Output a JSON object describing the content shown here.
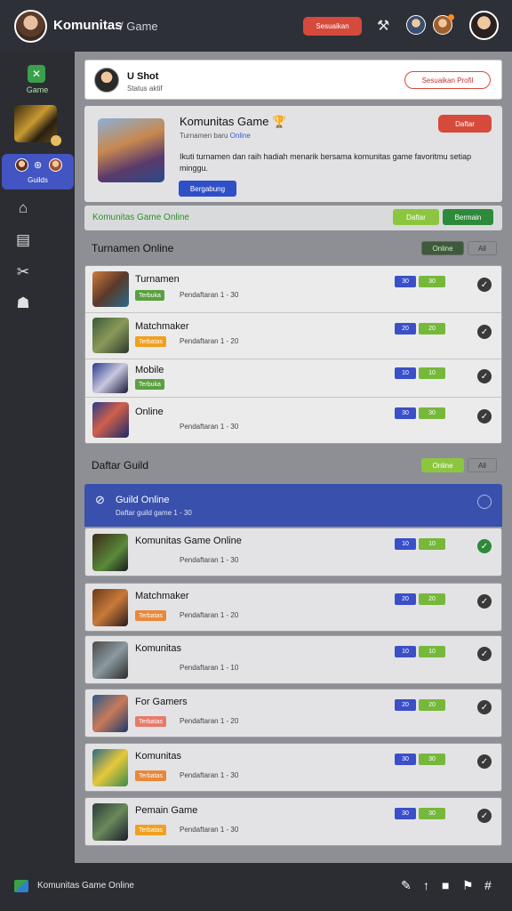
{
  "header": {
    "app_title": "Komunitas",
    "app_subtitle": "/ Game",
    "action_button_label": "Sesuaikan",
    "tool_icon": "wrench-icon"
  },
  "sidebar": {
    "logo_label": "Game",
    "active_item_label": "Guilds",
    "items": [
      "home-icon",
      "list-icon",
      "tools-icon",
      "gamepad-icon"
    ]
  },
  "profile_card": {
    "name": "U Shot",
    "subtitle": "Status aktif",
    "button_label": "Sesuaikan Profil"
  },
  "promo": {
    "title": "Komunitas Game",
    "subtitle": "Turnamen baru",
    "subtitle_highlight": "Online",
    "description": "Ikuti turnamen dan raih hadiah menarik bersama komunitas game favoritmu setiap minggu.",
    "primary_button": "Bergabung",
    "red_button": "Daftar"
  },
  "strip": {
    "text": "Komunitas Game Online",
    "button1": "Daftar",
    "button2": "Bermain"
  },
  "section1": {
    "title": "Turnamen Online",
    "button1": "Online",
    "button2": "All"
  },
  "tournaments": [
    {
      "title": "Turnamen",
      "tag": "Terbuka",
      "tag_color": "#5aa040",
      "meta": "Pendaftaran 1 - 30",
      "b1": "30",
      "b2": "30",
      "thumb": "linear-gradient(135deg,#d07a3a,#5a3a2a 50%,#2a6a8a)"
    },
    {
      "title": "Matchmaker",
      "tag": "Terbatas",
      "tag_color": "#f0a020",
      "meta": "Pendaftaran 1 - 20",
      "b1": "20",
      "b2": "20",
      "thumb": "linear-gradient(135deg,#3a5a3a,#8a9a5a 50%,#2a3a2a)"
    },
    {
      "title": "Mobile",
      "tag": "Terbuka",
      "tag_color": "#5aa040",
      "meta": "",
      "b1": "10",
      "b2": "10",
      "thumb": "linear-gradient(135deg,#2a3a8a,#c8c8e0 50%,#1a1a3a)"
    },
    {
      "title": "Online",
      "tag": "",
      "tag_color": "",
      "tag_text_color": "#2f8f2a",
      "meta": "Pendaftaran 1 - 30",
      "b1": "30",
      "b2": "30",
      "thumb": "linear-gradient(135deg,#2a3a8a,#d0604a 45%,#1a2a6a)"
    }
  ],
  "section2": {
    "title": "Daftar Guild",
    "button1": "Online",
    "button2": "All"
  },
  "guild_header": {
    "title": "Guild Online",
    "subtitle": "Daftar guild game 1 - 30"
  },
  "guilds": [
    {
      "title": "Komunitas Game Online",
      "tag": "",
      "tag_color": "",
      "tag_text_color": "#2f8f2a",
      "meta": "Pendaftaran 1 - 30",
      "b1": "10",
      "b2": "10",
      "thumb": "linear-gradient(135deg,#3a2a1a,#5a8a3a 60%,#1a1a1a)",
      "check_color": "#2d8a3a"
    },
    {
      "title": "Matchmaker",
      "tag": "Terbatas",
      "tag_color": "#e8883a",
      "meta": "Pendaftaran 1 - 20",
      "b1": "20",
      "b2": "20",
      "thumb": "linear-gradient(135deg,#6a3a1a,#c87a3a 50%,#2a1a1a)"
    },
    {
      "title": "Komunitas",
      "tag": "",
      "tag_color": "",
      "meta": "Pendaftaran 1 - 10",
      "b1": "10",
      "b2": "10",
      "thumb": "linear-gradient(135deg,#4a4a4a,#8a9aa0 50%,#2a2a2a)"
    },
    {
      "title": "For Gamers",
      "tag": "Terbatas",
      "tag_color": "#e87a6a",
      "meta": "Pendaftaran 1 - 20",
      "b1": "20",
      "b2": "20",
      "thumb": "linear-gradient(135deg,#2a5a8a,#c87a5a 50%,#1a3a6a)"
    },
    {
      "title": "Komunitas",
      "tag": "Terbatas",
      "tag_color": "#e8883a",
      "meta": "Pendaftaran 1 - 30",
      "b1": "30",
      "b2": "30",
      "thumb": "linear-gradient(135deg,#2a6a8a,#e8c83a 50%,#3a8a4a)"
    },
    {
      "title": "Pemain Game",
      "tag": "Terbatas",
      "tag_color": "#f0a020",
      "meta": "Pendaftaran 1 - 30",
      "b1": "30",
      "b2": "30",
      "thumb": "linear-gradient(135deg,#2a3a3a,#6a8a5a 50%,#1a1a2a)"
    }
  ],
  "footer": {
    "text": "Komunitas Game Online",
    "icons": [
      "pin-icon",
      "up-arrow-icon",
      "page-icon",
      "flag-icon",
      "grid-icon"
    ]
  },
  "colors": {
    "accent": "#3950ac",
    "danger": "#d64a3b",
    "success": "#2d8a3a"
  }
}
